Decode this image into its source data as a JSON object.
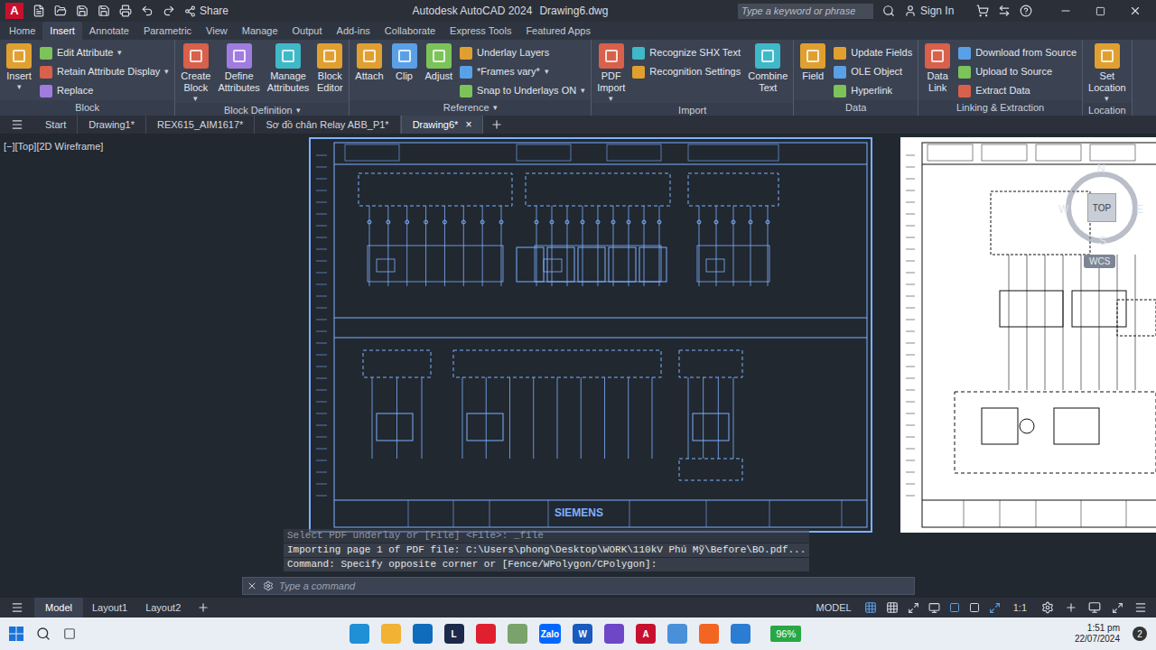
{
  "title_bar": {
    "app_letter": "A",
    "share": "Share",
    "app": "Autodesk AutoCAD 2024",
    "document": "Drawing6.dwg",
    "search_placeholder": "Type a keyword or phrase",
    "sign_in": "Sign In"
  },
  "ribbon_tabs": [
    {
      "label": "Home",
      "selected": false
    },
    {
      "label": "Insert",
      "selected": true
    },
    {
      "label": "Annotate",
      "selected": false
    },
    {
      "label": "Parametric",
      "selected": false
    },
    {
      "label": "View",
      "selected": false
    },
    {
      "label": "Manage",
      "selected": false
    },
    {
      "label": "Output",
      "selected": false
    },
    {
      "label": "Add-ins",
      "selected": false
    },
    {
      "label": "Collaborate",
      "selected": false
    },
    {
      "label": "Express Tools",
      "selected": false
    },
    {
      "label": "Featured Apps",
      "selected": false
    }
  ],
  "ribbon_panels": [
    {
      "label": "Block",
      "arrow": "",
      "items": [
        {
          "kind": "large",
          "lines": [
            "Insert"
          ],
          "arrow": "▾"
        },
        {
          "kind": "stack",
          "entries": [
            {
              "label": "Edit Attribute",
              "arrow": "▾"
            },
            {
              "label": "Retain Attribute Display",
              "arrow": "▾"
            },
            {
              "label": "Replace",
              "arrow": ""
            }
          ]
        }
      ]
    },
    {
      "label": "Block Definition",
      "arrow": "▾",
      "items": [
        {
          "kind": "large",
          "lines": [
            "Create",
            "Block"
          ],
          "arrow": "▾"
        },
        {
          "kind": "large",
          "lines": [
            "Define",
            "Attributes"
          ],
          "arrow": ""
        },
        {
          "kind": "large",
          "lines": [
            "Manage",
            "Attributes"
          ],
          "arrow": ""
        },
        {
          "kind": "large",
          "lines": [
            "Block",
            "Editor"
          ],
          "arrow": ""
        }
      ]
    },
    {
      "label": "Reference",
      "arrow": "▾",
      "items": [
        {
          "kind": "large",
          "lines": [
            "Attach"
          ],
          "arrow": ""
        },
        {
          "kind": "large",
          "lines": [
            "Clip"
          ],
          "arrow": ""
        },
        {
          "kind": "large",
          "lines": [
            "Adjust"
          ],
          "arrow": ""
        },
        {
          "kind": "stack",
          "entries": [
            {
              "label": "Underlay Layers",
              "arrow": ""
            },
            {
              "label": "*Frames vary*",
              "arrow": "▾"
            },
            {
              "label": "Snap to Underlays ON",
              "arrow": "▾"
            }
          ]
        }
      ]
    },
    {
      "label": "Import",
      "arrow": "",
      "items": [
        {
          "kind": "large",
          "lines": [
            "PDF",
            "Import"
          ],
          "arrow": "▾"
        },
        {
          "kind": "stack",
          "entries": [
            {
              "label": "Recognize SHX Text",
              "arrow": ""
            },
            {
              "label": "Recognition Settings",
              "arrow": ""
            }
          ]
        },
        {
          "kind": "large",
          "lines": [
            "Combine",
            "Text"
          ],
          "arrow": ""
        }
      ]
    },
    {
      "label": "Data",
      "arrow": "",
      "items": [
        {
          "kind": "large",
          "lines": [
            "Field"
          ],
          "arrow": ""
        },
        {
          "kind": "stack",
          "entries": [
            {
              "label": "Update Fields",
              "arrow": ""
            },
            {
              "label": "OLE Object",
              "arrow": ""
            },
            {
              "label": "Hyperlink",
              "arrow": ""
            }
          ]
        }
      ]
    },
    {
      "label": "Linking & Extraction",
      "arrow": "",
      "items": [
        {
          "kind": "large",
          "lines": [
            "Data",
            "Link"
          ],
          "arrow": ""
        },
        {
          "kind": "stack",
          "entries": [
            {
              "label": "Download from Source",
              "arrow": ""
            },
            {
              "label": "Upload to Source",
              "arrow": ""
            },
            {
              "label": "Extract  Data",
              "arrow": ""
            }
          ]
        }
      ]
    },
    {
      "label": "Location",
      "arrow": "",
      "items": [
        {
          "kind": "large",
          "lines": [
            "Set",
            "Location"
          ],
          "arrow": "▾"
        }
      ]
    }
  ],
  "file_tabs": [
    {
      "label": "Start",
      "selected": false,
      "close": ""
    },
    {
      "label": "Drawing1*",
      "selected": false,
      "close": ""
    },
    {
      "label": "REX615_AIM1617*",
      "selected": false,
      "close": ""
    },
    {
      "label": "Sơ đồ chân Relay ABB_P1*",
      "selected": false,
      "close": ""
    },
    {
      "label": "Drawing6*",
      "selected": true,
      "close": "×"
    }
  ],
  "viewport": {
    "label": "[−][Top][2D Wireframe]",
    "sheet_brand": "SIEMENS",
    "viewcube": {
      "top": "TOP",
      "north": "N",
      "south": "S",
      "east": "E",
      "west": "W",
      "ucs": "WCS"
    }
  },
  "command_history": [
    {
      "text": "Select PDF underlay or [File] <File>: _file",
      "faded": true
    },
    {
      "text": "Importing page 1 of PDF file: C:\\Users\\phong\\Desktop\\WORK\\110kV Phú Mỹ\\Before\\BO.pdf...",
      "faded": false
    },
    {
      "text": "Command: Specify opposite corner or [Fence/WPolygon/CPolygon]:",
      "faded": false
    }
  ],
  "command_placeholder": "Type a command",
  "layout_tabs": [
    {
      "label": "Model",
      "selected": true
    },
    {
      "label": "Layout1",
      "selected": false
    },
    {
      "label": "Layout2",
      "selected": false
    }
  ],
  "status": {
    "mode": "MODEL",
    "scale": "1:1"
  },
  "taskbar": {
    "apps": [
      {
        "glyph": "",
        "color": "#1f8fd6"
      },
      {
        "glyph": "",
        "color": "#f2b233"
      },
      {
        "glyph": "",
        "color": "#0f6cbd"
      },
      {
        "glyph": "L",
        "color": "#1b2a4a"
      },
      {
        "glyph": "",
        "color": "#e0202e"
      },
      {
        "glyph": "",
        "color": "#7aa36b"
      },
      {
        "glyph": "Zalo",
        "color": "#0068ff"
      },
      {
        "glyph": "W",
        "color": "#185abd"
      },
      {
        "glyph": "",
        "color": "#6e46c8"
      },
      {
        "glyph": "A",
        "color": "#c8102e"
      },
      {
        "glyph": "",
        "color": "#4a90d9"
      },
      {
        "glyph": "",
        "color": "#f26522"
      },
      {
        "glyph": "",
        "color": "#2b7cd3"
      }
    ],
    "battery": "96%",
    "time": "1:51 pm",
    "date": "22/07/2024",
    "notifications": "2"
  }
}
